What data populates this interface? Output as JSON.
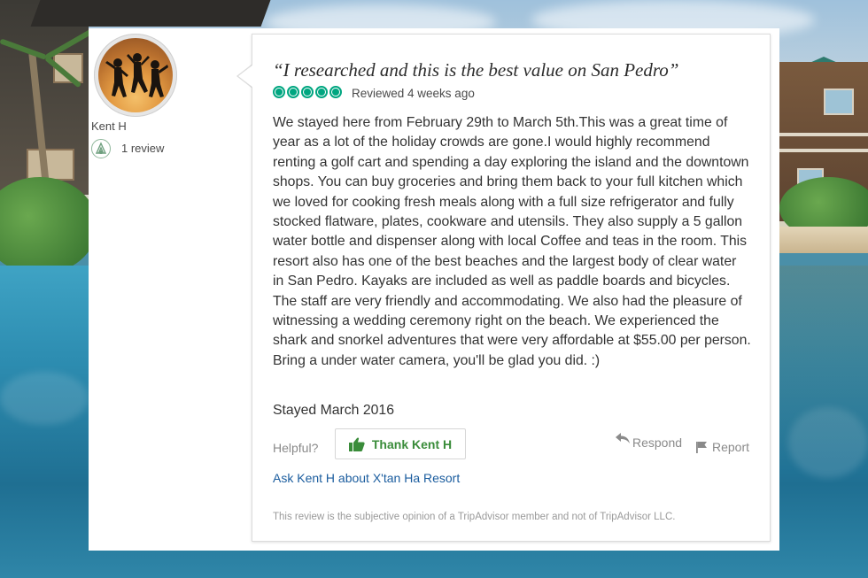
{
  "reviewer": {
    "name": "Kent H",
    "review_count": "1 review",
    "level_icon": "traveler-badge-icon",
    "avatar": "avatar-silhouettes-sunset"
  },
  "review": {
    "title": "“I researched and this is the best value on San Pedro”",
    "rating": 5,
    "rating_max": 5,
    "rating_color": "#00a680",
    "reviewed_date": "Reviewed 4 weeks ago",
    "body": "We stayed here from February 29th to March 5th.This was a great time of year as a lot of the holiday crowds are gone.I would highly recommend renting a golf cart and spending a day exploring the island and the downtown shops. You can buy groceries and bring them back to your full kitchen which we loved for cooking fresh meals along with a full size refrigerator and fully stocked flatware, plates, cookware and utensils. They also supply a 5 gallon water bottle and dispenser along with local Coffee and teas in the room. This resort also has one of the best beaches and the largest body of clear water in San Pedro. Kayaks are included as well as paddle boards and bicycles. The staff are very friendly and accommodating. We also had the pleasure of witnessing a wedding ceremony right on the beach. We experienced the shark and snorkel adventures that were very affordable at $55.00 per person. Bring a under water camera, you'll be glad you did. :)",
    "stayed": "Stayed March 2016"
  },
  "actions": {
    "helpful_label": "Helpful?",
    "thank_label": "Thank Kent H",
    "thank_icon": "thumbs-up-icon",
    "respond_label": "Respond",
    "respond_icon": "reply-arrow-icon",
    "report_label": "Report",
    "report_icon": "flag-icon",
    "ask_link": "Ask Kent H about X'tan Ha Resort"
  },
  "disclaimer": "This review is the subjective opinion of a TripAdvisor member and not of TripAdvisor LLC.",
  "colors": {
    "link": "#1a5c9e",
    "thank_green": "#3a8c3a",
    "bubble_green": "#00a680"
  }
}
